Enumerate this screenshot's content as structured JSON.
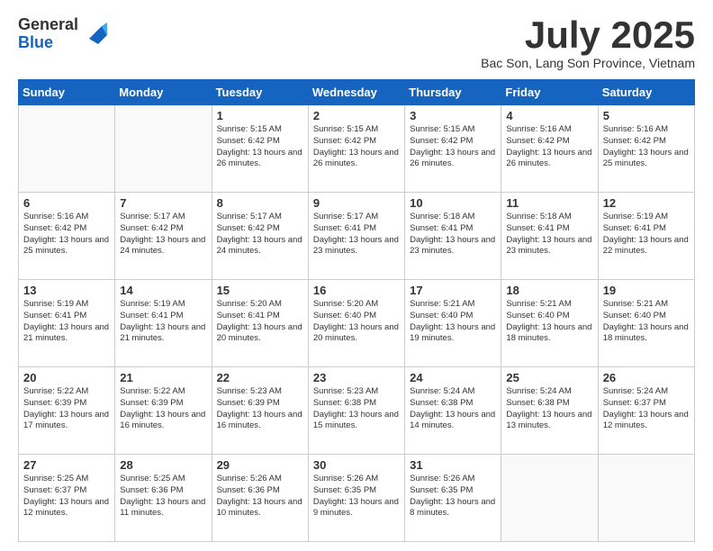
{
  "logo": {
    "general": "General",
    "blue": "Blue"
  },
  "title": "July 2025",
  "subtitle": "Bac Son, Lang Son Province, Vietnam",
  "days_of_week": [
    "Sunday",
    "Monday",
    "Tuesday",
    "Wednesday",
    "Thursday",
    "Friday",
    "Saturday"
  ],
  "weeks": [
    [
      {
        "day": "",
        "info": ""
      },
      {
        "day": "",
        "info": ""
      },
      {
        "day": "1",
        "info": "Sunrise: 5:15 AM\nSunset: 6:42 PM\nDaylight: 13 hours and 26 minutes."
      },
      {
        "day": "2",
        "info": "Sunrise: 5:15 AM\nSunset: 6:42 PM\nDaylight: 13 hours and 26 minutes."
      },
      {
        "day": "3",
        "info": "Sunrise: 5:15 AM\nSunset: 6:42 PM\nDaylight: 13 hours and 26 minutes."
      },
      {
        "day": "4",
        "info": "Sunrise: 5:16 AM\nSunset: 6:42 PM\nDaylight: 13 hours and 26 minutes."
      },
      {
        "day": "5",
        "info": "Sunrise: 5:16 AM\nSunset: 6:42 PM\nDaylight: 13 hours and 25 minutes."
      }
    ],
    [
      {
        "day": "6",
        "info": "Sunrise: 5:16 AM\nSunset: 6:42 PM\nDaylight: 13 hours and 25 minutes."
      },
      {
        "day": "7",
        "info": "Sunrise: 5:17 AM\nSunset: 6:42 PM\nDaylight: 13 hours and 24 minutes."
      },
      {
        "day": "8",
        "info": "Sunrise: 5:17 AM\nSunset: 6:42 PM\nDaylight: 13 hours and 24 minutes."
      },
      {
        "day": "9",
        "info": "Sunrise: 5:17 AM\nSunset: 6:41 PM\nDaylight: 13 hours and 23 minutes."
      },
      {
        "day": "10",
        "info": "Sunrise: 5:18 AM\nSunset: 6:41 PM\nDaylight: 13 hours and 23 minutes."
      },
      {
        "day": "11",
        "info": "Sunrise: 5:18 AM\nSunset: 6:41 PM\nDaylight: 13 hours and 23 minutes."
      },
      {
        "day": "12",
        "info": "Sunrise: 5:19 AM\nSunset: 6:41 PM\nDaylight: 13 hours and 22 minutes."
      }
    ],
    [
      {
        "day": "13",
        "info": "Sunrise: 5:19 AM\nSunset: 6:41 PM\nDaylight: 13 hours and 21 minutes."
      },
      {
        "day": "14",
        "info": "Sunrise: 5:19 AM\nSunset: 6:41 PM\nDaylight: 13 hours and 21 minutes."
      },
      {
        "day": "15",
        "info": "Sunrise: 5:20 AM\nSunset: 6:41 PM\nDaylight: 13 hours and 20 minutes."
      },
      {
        "day": "16",
        "info": "Sunrise: 5:20 AM\nSunset: 6:40 PM\nDaylight: 13 hours and 20 minutes."
      },
      {
        "day": "17",
        "info": "Sunrise: 5:21 AM\nSunset: 6:40 PM\nDaylight: 13 hours and 19 minutes."
      },
      {
        "day": "18",
        "info": "Sunrise: 5:21 AM\nSunset: 6:40 PM\nDaylight: 13 hours and 18 minutes."
      },
      {
        "day": "19",
        "info": "Sunrise: 5:21 AM\nSunset: 6:40 PM\nDaylight: 13 hours and 18 minutes."
      }
    ],
    [
      {
        "day": "20",
        "info": "Sunrise: 5:22 AM\nSunset: 6:39 PM\nDaylight: 13 hours and 17 minutes."
      },
      {
        "day": "21",
        "info": "Sunrise: 5:22 AM\nSunset: 6:39 PM\nDaylight: 13 hours and 16 minutes."
      },
      {
        "day": "22",
        "info": "Sunrise: 5:23 AM\nSunset: 6:39 PM\nDaylight: 13 hours and 16 minutes."
      },
      {
        "day": "23",
        "info": "Sunrise: 5:23 AM\nSunset: 6:38 PM\nDaylight: 13 hours and 15 minutes."
      },
      {
        "day": "24",
        "info": "Sunrise: 5:24 AM\nSunset: 6:38 PM\nDaylight: 13 hours and 14 minutes."
      },
      {
        "day": "25",
        "info": "Sunrise: 5:24 AM\nSunset: 6:38 PM\nDaylight: 13 hours and 13 minutes."
      },
      {
        "day": "26",
        "info": "Sunrise: 5:24 AM\nSunset: 6:37 PM\nDaylight: 13 hours and 12 minutes."
      }
    ],
    [
      {
        "day": "27",
        "info": "Sunrise: 5:25 AM\nSunset: 6:37 PM\nDaylight: 13 hours and 12 minutes."
      },
      {
        "day": "28",
        "info": "Sunrise: 5:25 AM\nSunset: 6:36 PM\nDaylight: 13 hours and 11 minutes."
      },
      {
        "day": "29",
        "info": "Sunrise: 5:26 AM\nSunset: 6:36 PM\nDaylight: 13 hours and 10 minutes."
      },
      {
        "day": "30",
        "info": "Sunrise: 5:26 AM\nSunset: 6:35 PM\nDaylight: 13 hours and 9 minutes."
      },
      {
        "day": "31",
        "info": "Sunrise: 5:26 AM\nSunset: 6:35 PM\nDaylight: 13 hours and 8 minutes."
      },
      {
        "day": "",
        "info": ""
      },
      {
        "day": "",
        "info": ""
      }
    ]
  ]
}
